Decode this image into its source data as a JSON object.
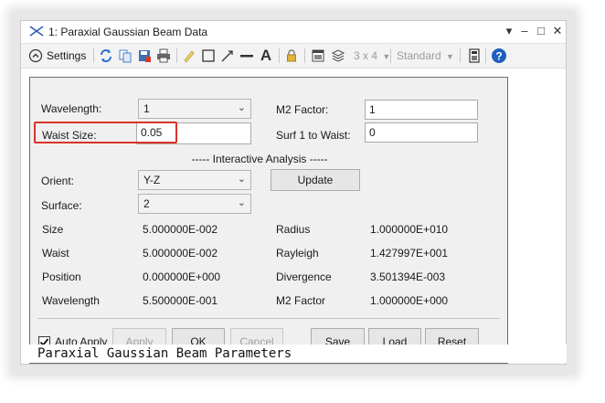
{
  "window": {
    "title": "1: Paraxial Gaussian Beam Data",
    "controls": {
      "menu": "▾",
      "minimize": "–",
      "maximize": "□",
      "close": "✕"
    }
  },
  "toolbar": {
    "settings_label": "Settings",
    "layout_label": "3 x 4",
    "style_label": "Standard"
  },
  "form": {
    "wavelength_label": "Wavelength:",
    "wavelength_value": "1",
    "m2_label": "M2 Factor:",
    "m2_value": "1",
    "waist_label": "Waist Size:",
    "waist_value": "0.05",
    "surf_label": "Surf 1 to Waist:",
    "surf_value": "0",
    "section_title": "----- Interactive Analysis -----",
    "orient_label": "Orient:",
    "orient_value": "Y-Z",
    "update_label": "Update",
    "surface_label": "Surface:",
    "surface_value": "2"
  },
  "results": {
    "left": [
      {
        "label": "Size",
        "value": "5.000000E-002"
      },
      {
        "label": "Waist",
        "value": "5.000000E-002"
      },
      {
        "label": "Position",
        "value": "0.000000E+000"
      },
      {
        "label": "Wavelength",
        "value": "5.500000E-001"
      }
    ],
    "right": [
      {
        "label": "Radius",
        "value": "1.000000E+010"
      },
      {
        "label": "Rayleigh",
        "value": "1.427997E+001"
      },
      {
        "label": "Divergence",
        "value": "3.501394E-003"
      },
      {
        "label": "M2 Factor",
        "value": "1.000000E+000"
      }
    ]
  },
  "buttons": {
    "auto_apply": "Auto Apply",
    "apply": "Apply",
    "ok": "OK",
    "cancel": "Cancel",
    "save": "Save",
    "load": "Load",
    "reset": "Reset"
  },
  "output_text": "Paraxial Gaussian Beam Parameters",
  "colors": {
    "highlight": "#d9342b",
    "accent": "#1f5fbf"
  }
}
